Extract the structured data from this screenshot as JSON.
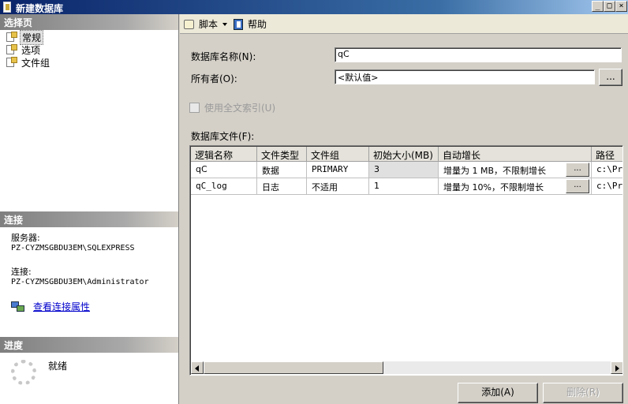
{
  "window": {
    "title": "新建数据库"
  },
  "left": {
    "select_page_header": "选择页",
    "nav": [
      {
        "label": "常规",
        "selected": true
      },
      {
        "label": "选项",
        "selected": false
      },
      {
        "label": "文件组",
        "selected": false
      }
    ],
    "connection_header": "连接",
    "server_label": "服务器:",
    "server_value": "PZ-CYZMSGBDU3EM\\SQLEXPRESS",
    "connection_label": "连接:",
    "connection_value": "PZ-CYZMSGBDU3EM\\Administrator",
    "view_props_link": "查看连接属性",
    "progress_header": "进度",
    "progress_status": "就绪"
  },
  "toolbar": {
    "script_label": "脚本",
    "help_label": "帮助"
  },
  "form": {
    "dbname_label": "数据库名称(N):",
    "dbname_value": "qC",
    "owner_label": "所有者(O):",
    "owner_value": "<默认值>",
    "browse_label": "...",
    "fulltext_label": "使用全文索引(U)",
    "files_label": "数据库文件(F):"
  },
  "grid": {
    "columns": [
      "逻辑名称",
      "文件类型",
      "文件组",
      "初始大小(MB)",
      "自动增长",
      "路径"
    ],
    "rows": [
      [
        "qC",
        "数据",
        "PRIMARY",
        "3",
        "增量为 1 MB，不限制增长",
        "c:\\Pro"
      ],
      [
        "qC_log",
        "日志",
        "不适用",
        "1",
        "增量为 10%，不限制增长",
        "c:\\Pro"
      ]
    ],
    "dots_label": "..."
  },
  "buttons": {
    "add_label": "添加(A)",
    "remove_label": "删除(R)"
  },
  "colors": {
    "titlebar": "#0a246a",
    "link": "#0000cc",
    "face": "#d4d0c8"
  }
}
